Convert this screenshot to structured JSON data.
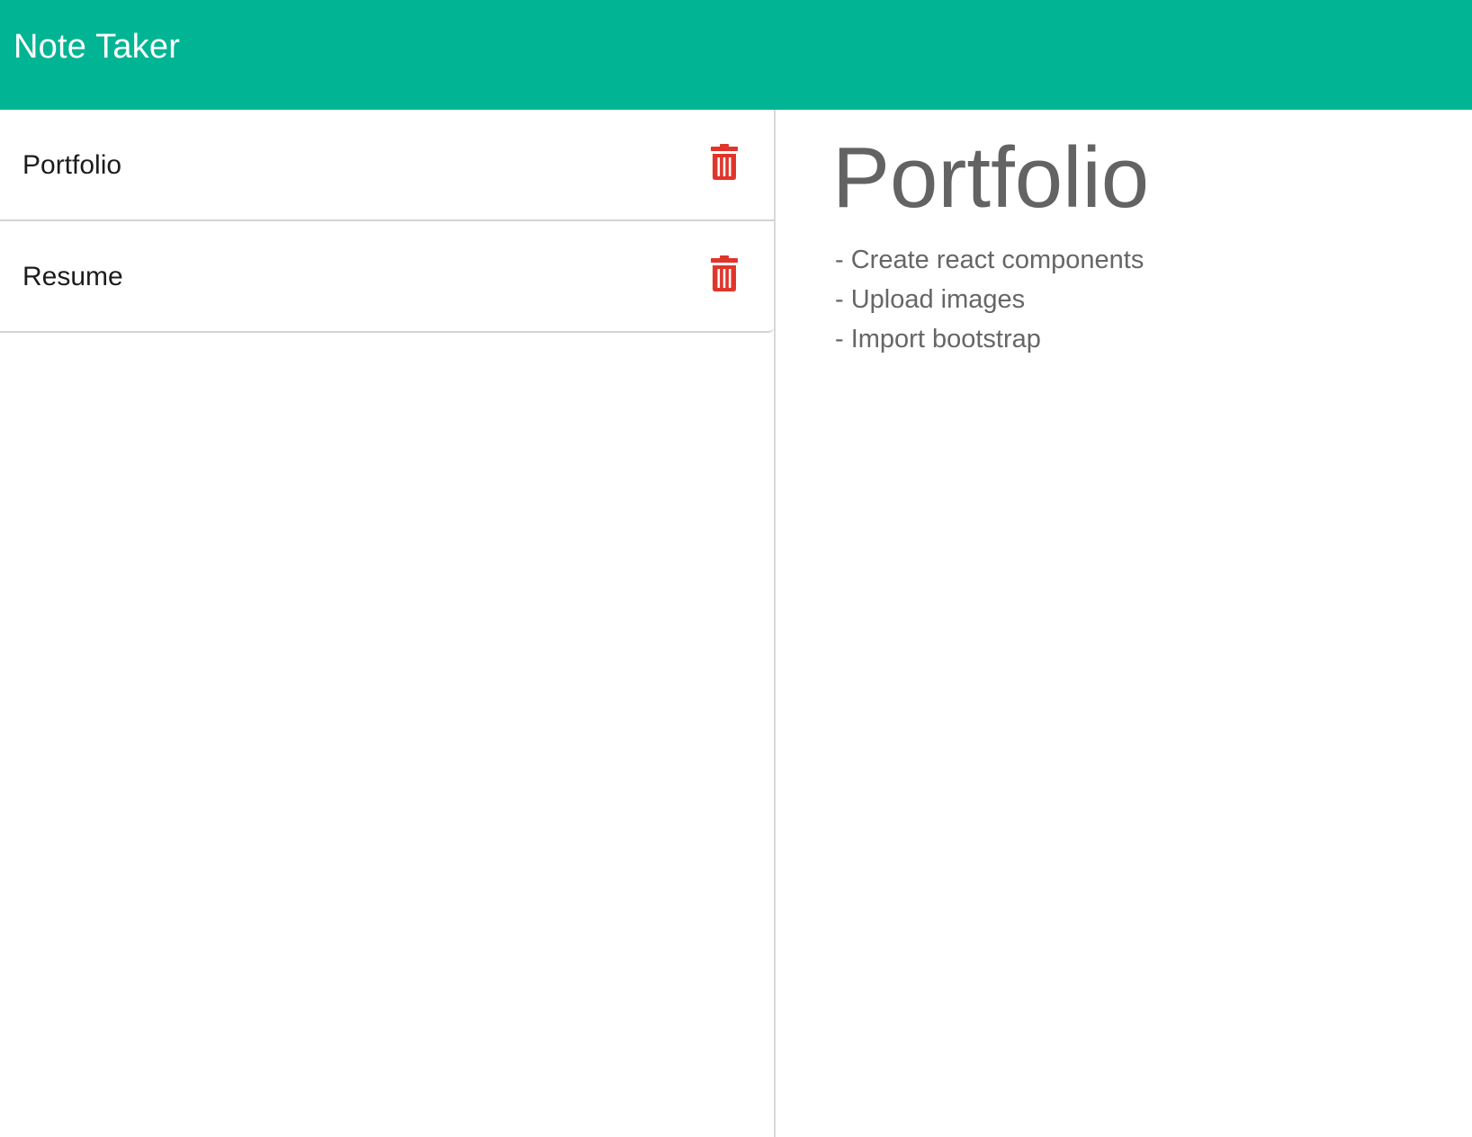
{
  "app": {
    "title": "Note Taker",
    "accent_color": "#00b494",
    "danger_color": "#e0352b"
  },
  "notes": [
    {
      "title": "Portfolio",
      "delete_icon": "trash-icon"
    },
    {
      "title": "Resume",
      "delete_icon": "trash-icon"
    }
  ],
  "active_note": {
    "title": "Portfolio",
    "lines": [
      "- Create react components",
      "- Upload images",
      "- Import bootstrap"
    ]
  }
}
